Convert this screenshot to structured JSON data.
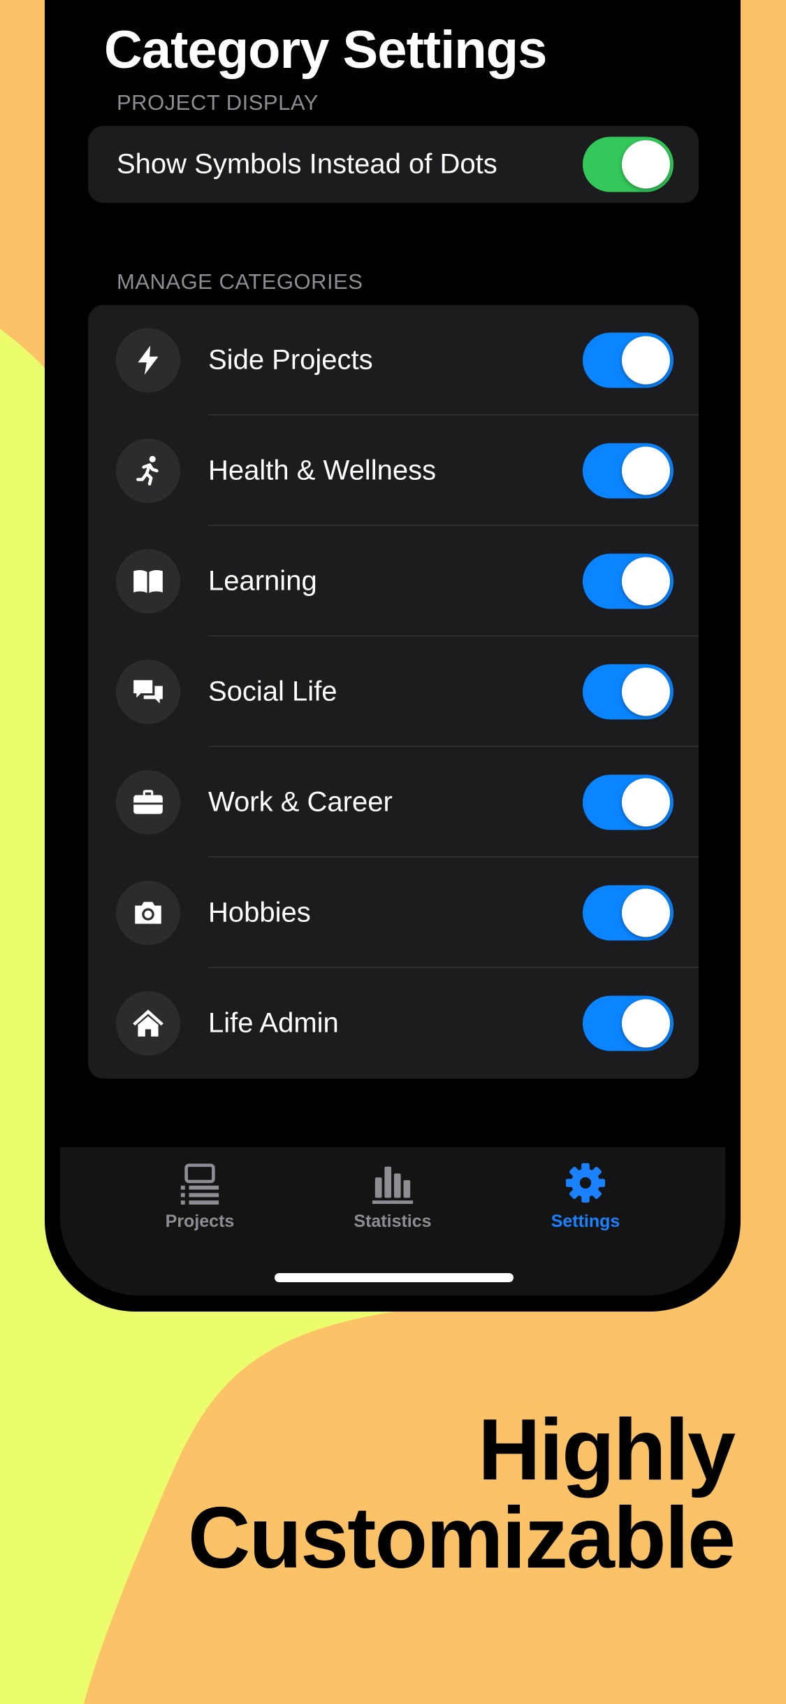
{
  "title": "Category Settings",
  "colors": {
    "background_orange": "#FBC267",
    "background_yellow": "#EBFC6D",
    "toggle_green": "#34C759",
    "toggle_blue": "#0A84FF",
    "tab_active": "#1A82FF"
  },
  "project_display": {
    "header": "PROJECT DISPLAY",
    "row_label": "Show Symbols Instead of Dots",
    "toggle_on": true
  },
  "manage_categories": {
    "header": "MANAGE CATEGORIES",
    "items": [
      {
        "label": "Side Projects",
        "icon": "bolt-icon",
        "toggle_on": true
      },
      {
        "label": "Health & Wellness",
        "icon": "running-figure-icon",
        "toggle_on": true
      },
      {
        "label": "Learning",
        "icon": "book-icon",
        "toggle_on": true
      },
      {
        "label": "Social Life",
        "icon": "chat-bubbles-icon",
        "toggle_on": true
      },
      {
        "label": "Work & Career",
        "icon": "briefcase-icon",
        "toggle_on": true
      },
      {
        "label": "Hobbies",
        "icon": "camera-icon",
        "toggle_on": true
      },
      {
        "label": "Life Admin",
        "icon": "house-icon",
        "toggle_on": true
      }
    ]
  },
  "tabs": [
    {
      "label": "Projects",
      "icon": "projects-list-icon",
      "active": false
    },
    {
      "label": "Statistics",
      "icon": "bar-chart-icon",
      "active": false
    },
    {
      "label": "Settings",
      "icon": "gear-icon",
      "active": true
    }
  ],
  "tagline": {
    "line1": "Highly",
    "line2": "Customizable"
  }
}
